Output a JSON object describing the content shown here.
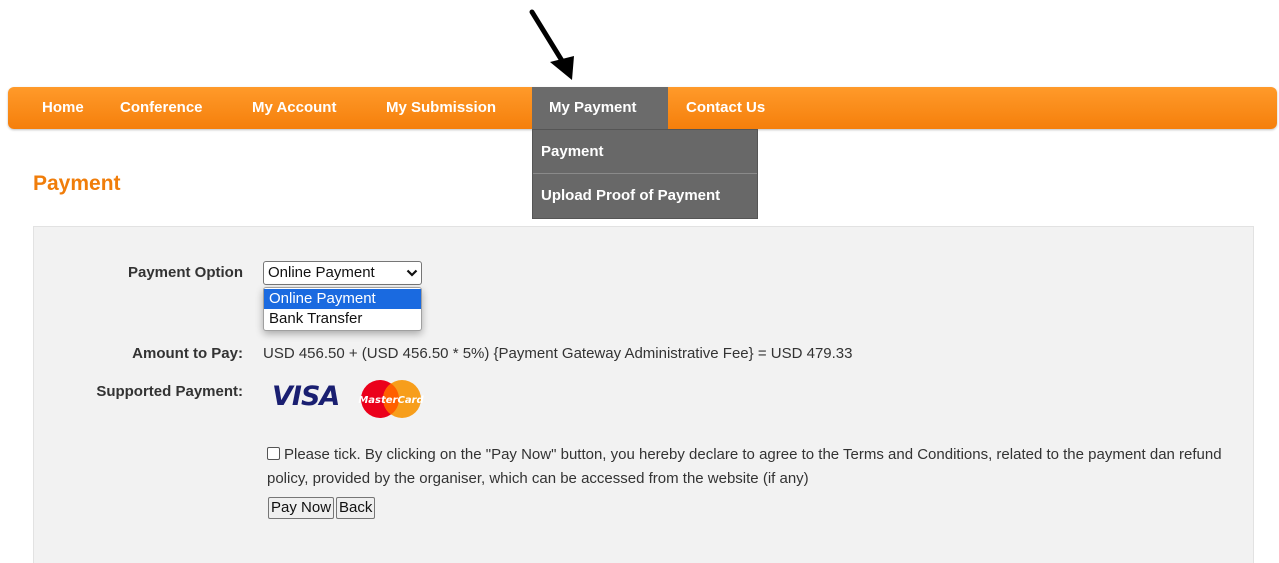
{
  "nav": {
    "items": [
      {
        "label": "Home"
      },
      {
        "label": "Conference"
      },
      {
        "label": "My Account"
      },
      {
        "label": "My Submission"
      },
      {
        "label": "My Payment"
      },
      {
        "label": "Contact Us"
      }
    ],
    "active": "My Payment",
    "dropdown": [
      {
        "label": "Payment"
      },
      {
        "label": "Upload Proof of Payment"
      }
    ]
  },
  "page": {
    "title": "Payment"
  },
  "form": {
    "payment_option_label": "Payment Option",
    "payment_option_value": "Online Payment",
    "payment_options": [
      "Online Payment",
      "Bank Transfer"
    ],
    "amount_label": "Amount to Pay:",
    "amount_text": "USD 456.50 + (USD 456.50 * 5%) {Payment Gateway Administrative Fee} = USD 479.33",
    "supported_label": "Supported Payment:",
    "cards": {
      "visa": "VISA",
      "mastercard": "MasterCard"
    },
    "agree_text": "Please tick. By clicking on the \"Pay Now\" button, you hereby declare to agree to the Terms and Conditions, related to the payment dan refund policy, provided by the organiser, which can be accessed from the website (if any)",
    "agree_checked": false,
    "pay_now_label": "Pay Now",
    "back_label": "Back"
  },
  "colors": {
    "nav_orange": "#f7870f",
    "nav_active": "#6b6b6b",
    "title_orange": "#f07d0a",
    "select_highlight": "#1a6ae0",
    "visa_blue": "#1a1f71"
  },
  "icons": {
    "annotation": "arrow-down-right-icon",
    "select": "chevron-down-icon",
    "card": "mastercard-logo"
  }
}
